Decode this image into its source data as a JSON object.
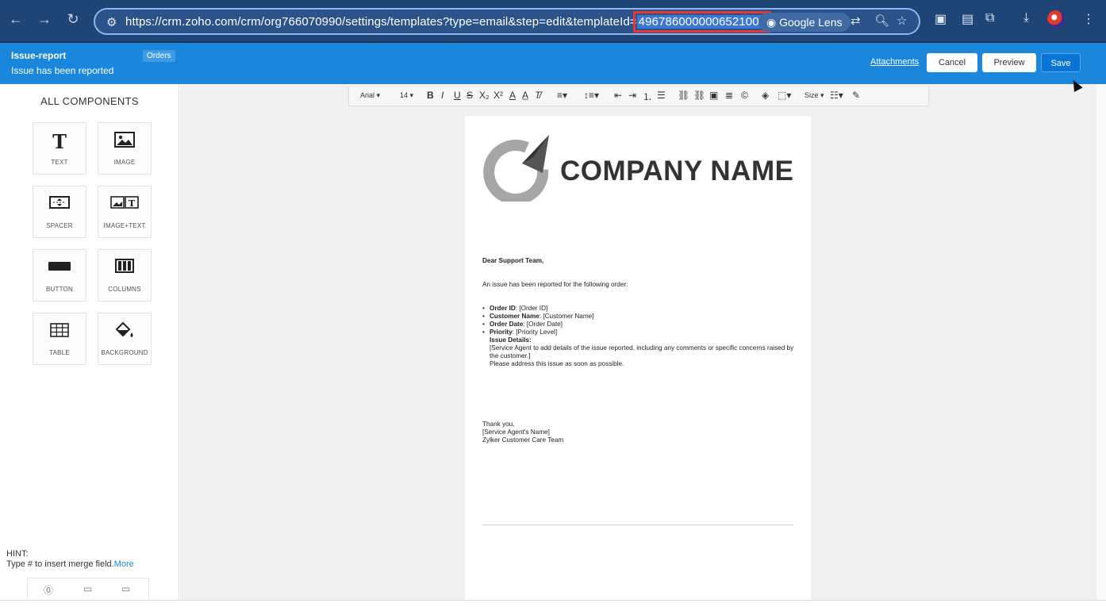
{
  "browser": {
    "back": "←",
    "forward": "→",
    "reload": "↻",
    "url_prefix": "https://crm.zoho.com/crm/org766070990/settings/templates?type=email&step=edit&templateId=",
    "url_highlight": "4967860000006521006",
    "lens_label": "Google Lens"
  },
  "header": {
    "template_name": "Issue-report",
    "template_subject": "Issue has been reported",
    "module_badge": "Orders",
    "attachments_label": "Attachments",
    "cancel_label": "Cancel",
    "preview_label": "Preview",
    "save_label": "Save"
  },
  "sidebar": {
    "title": "ALL COMPONENTS",
    "components": [
      {
        "label": "TEXT",
        "icon": "text-icon"
      },
      {
        "label": "IMAGE",
        "icon": "image-icon"
      },
      {
        "label": "SPACER",
        "icon": "spacer-icon"
      },
      {
        "label": "IMAGE+TEXT",
        "icon": "image-text-icon"
      },
      {
        "label": "BUTTON",
        "icon": "button-icon"
      },
      {
        "label": "COLUMNS",
        "icon": "columns-icon"
      },
      {
        "label": "TABLE",
        "icon": "table-icon"
      },
      {
        "label": "BACKGROUND",
        "icon": "paint-bucket-icon"
      }
    ],
    "hint_title": "HINT:",
    "hint_text": "Type # to insert merge field.",
    "hint_more": "More"
  },
  "toolbar": {
    "font": "Arial ▾",
    "size": "14 ▾",
    "size_menu": "Size ▾"
  },
  "email": {
    "logo_text": "COMPANY NAME",
    "greeting": "Dear Support Team,",
    "intro": "An issue has been reported for the following order:",
    "fields": [
      {
        "label": "Order ID",
        "value": ": [Order ID]"
      },
      {
        "label": "Customer Name",
        "value": ": [Customer Name]"
      },
      {
        "label": "Order Date",
        "value": ": [Order Date]"
      },
      {
        "label": "Priority",
        "value": ": [Priority Level]"
      }
    ],
    "details_label": "Issue Details:",
    "details_text": "[Service Agent to add details of the issue reported, including any comments or specific concerns raised by the customer.]",
    "request": "Please address this issue as soon as possible.",
    "closing": "Thank you,",
    "agent": "[Service Agent's Name]",
    "team": "Zylker Customer Care Team"
  }
}
